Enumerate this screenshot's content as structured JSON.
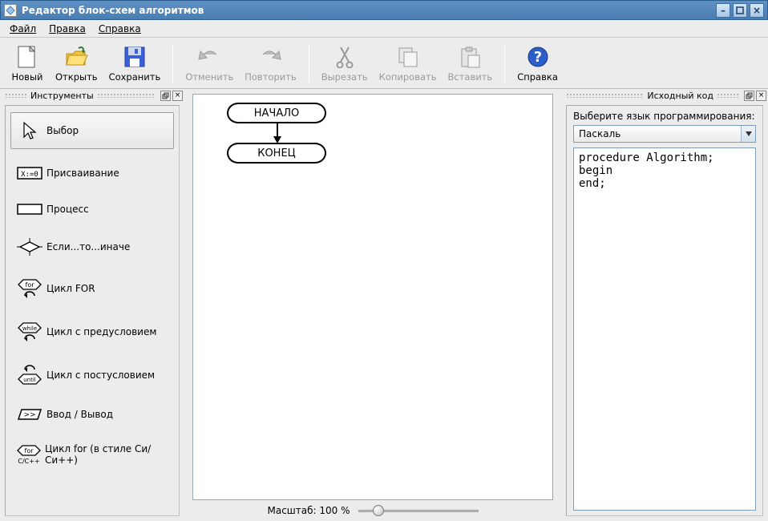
{
  "window": {
    "title": "Редактор блок-схем алгоритмов"
  },
  "menu": {
    "file": "Файл",
    "edit": "Правка",
    "help": "Справка"
  },
  "toolbar": {
    "new": "Новый",
    "open": "Открыть",
    "save": "Сохранить",
    "undo": "Отменить",
    "redo": "Повторить",
    "cut": "Вырезать",
    "copy": "Копировать",
    "paste": "Вставить",
    "help": "Справка"
  },
  "palette": {
    "title": "Инструменты",
    "items": {
      "select": "Выбор",
      "assign": "Присваивание",
      "process": "Процесс",
      "if_else": "Если...то...иначе",
      "for_loop": "Цикл FOR",
      "while_loop": "Цикл с предусловием",
      "until_loop": "Цикл с постусловием",
      "io": "Ввод / Вывод",
      "cfor": "Цикл for (в стиле Си/Си++)"
    }
  },
  "canvas": {
    "start_label": "НАЧАЛО",
    "end_label": "КОНЕЦ",
    "zoom_label": "Масштаб: 100 %",
    "zoom_value": 100
  },
  "source": {
    "title": "Исходный код",
    "choose_lang": "Выберите язык программирования:",
    "language": "Паскаль",
    "code": "procedure Algorithm;\nbegin\nend;"
  }
}
